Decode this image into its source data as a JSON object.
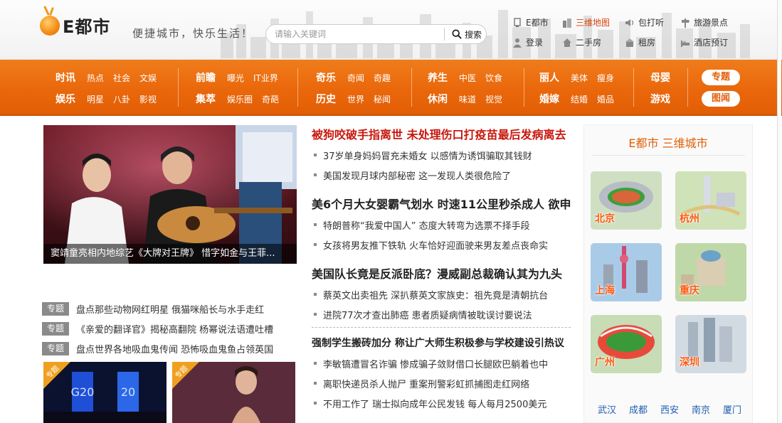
{
  "header": {
    "logo_text": "E都市",
    "slogan": "便捷城市，快乐生活！",
    "search": {
      "placeholder": "请输入关键词",
      "button_label": "搜索"
    },
    "top_links": [
      {
        "label": "E都市",
        "icon": "monitor-icon"
      },
      {
        "label": "三维地图",
        "icon": "building-icon"
      },
      {
        "label": "包打听",
        "icon": "speaker-icon"
      },
      {
        "label": "旅游景点",
        "icon": "signpost-icon"
      },
      {
        "label": "登录",
        "icon": "user-icon"
      },
      {
        "label": "二手房",
        "icon": "house-icon"
      },
      {
        "label": "租房",
        "icon": "rent-house-icon"
      },
      {
        "label": "酒店预订",
        "icon": "hotel-icon"
      }
    ]
  },
  "nav": {
    "groups": [
      {
        "rows": [
          {
            "main": "时讯",
            "subs": [
              "热点",
              "社会",
              "文娱"
            ]
          },
          {
            "main": "娱乐",
            "subs": [
              "明星",
              "八卦",
              "影视"
            ]
          }
        ]
      },
      {
        "rows": [
          {
            "main": "前瞻",
            "subs": [
              "曝光",
              "IT业界"
            ]
          },
          {
            "main": "集萃",
            "subs": [
              "娱乐圈",
              "奇葩"
            ]
          }
        ]
      },
      {
        "rows": [
          {
            "main": "奇乐",
            "subs": [
              "奇闻",
              "奇趣"
            ]
          },
          {
            "main": "历史",
            "subs": [
              "世界",
              "秘闻"
            ]
          }
        ]
      },
      {
        "rows": [
          {
            "main": "养生",
            "subs": [
              "中医",
              "饮食"
            ]
          },
          {
            "main": "休闲",
            "subs": [
              "味道",
              "视觉"
            ]
          }
        ]
      },
      {
        "rows": [
          {
            "main": "丽人",
            "subs": [
              "美体",
              "瘦身"
            ]
          },
          {
            "main": "婚嫁",
            "subs": [
              "结婚",
              "婚品"
            ]
          }
        ]
      },
      {
        "rows": [
          {
            "main": "母婴",
            "subs": []
          },
          {
            "main": "游戏",
            "subs": []
          }
        ]
      }
    ],
    "pills": [
      "专题",
      "图闻"
    ]
  },
  "hero": {
    "caption": "窦靖童亮相内地综艺《大牌对王牌》 惜字如金与王菲..."
  },
  "topics": {
    "tag": "专题",
    "items": [
      "盘点那些动物网红明星 俄猫咪船长与水手走红",
      "《亲爱的翻译官》揭秘高翻院 杨幂说法语遭吐槽",
      "盘点世界各地吸血鬼传闻 恐怖吸血鬼鱼占领英国"
    ]
  },
  "thumbs": {
    "corner_label": "专题",
    "building_text": "G20"
  },
  "news": {
    "blocks": [
      {
        "headline": "被狗咬破手指离世 未处理伤口打疫苗最后发病离去",
        "style": "red",
        "items": [
          "37岁单身妈妈冒充未婚女 以感情为诱饵骗取其钱财",
          "美国发现月球内部秘密 这一发现人类很危险了"
        ]
      },
      {
        "headline": "美6个月大女婴霸气划水 时速11公里秒杀成人 欲申",
        "style": "normal",
        "items": [
          "特朗普称“我爱中国人” 态度大转弯为选票不择手段",
          "女孩将男友推下铁轨 火车恰好迎面驶来男友差点丧命实"
        ]
      },
      {
        "headline": "美国队长竟是反派卧底？漫威副总裁确认其为九头",
        "style": "normal",
        "items": [
          "蔡英文出卖祖先 深扒蔡英文家族史：祖先竟是清朝抗台",
          "进院77次才查出肺癌 患者质疑病情被耽误讨要说法"
        ]
      },
      {
        "headline": "强制学生搬砖加分 称让广大师生积极参与学校建设引热议",
        "style": "small",
        "items": [
          "李敏镐遭冒名诈骗 惨成骗子敛财借口长腿欧巴躺着也中",
          "离职快递员杀人抛尸 重案刑警彩虹抓捕图走红网络",
          "不用工作了 瑞士拟向成年公民发钱 每人每月2500美元"
        ]
      }
    ]
  },
  "cities": {
    "title": "E都市 三维城市",
    "tiles": [
      "北京",
      "杭州",
      "上海",
      "重庆",
      "广州",
      "深圳"
    ],
    "links": [
      "武汉",
      "成都",
      "西安",
      "南京",
      "厦门"
    ]
  },
  "colors": {
    "brand_orange": "#e9660a",
    "headline_red": "#c8170d",
    "link_blue": "#1e5fb0"
  }
}
